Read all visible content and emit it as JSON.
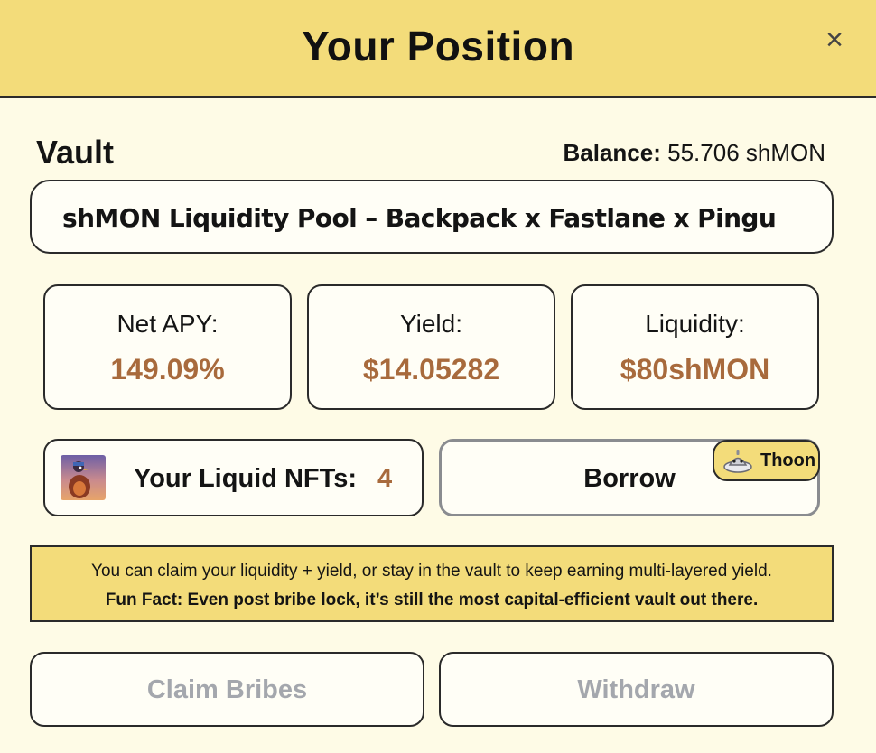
{
  "header": {
    "title": "Your Position",
    "close_icon": "close-icon"
  },
  "vault": {
    "label": "Vault",
    "balance_label": "Balance:",
    "balance_value": "55.706 shMON",
    "pool_name": "shMON Liquidity Pool – Backpack x Fastlane x Pingu"
  },
  "stats": [
    {
      "label": "Net APY:",
      "value": "149.09%"
    },
    {
      "label": "Yield:",
      "value": "$14.05282"
    },
    {
      "label": "Liquidity:",
      "value": "$80shMON"
    }
  ],
  "nfts": {
    "label": "Your Liquid NFTs:",
    "count": "4"
  },
  "borrow": {
    "label": "Borrow",
    "badge": "Thoon"
  },
  "notice": {
    "line1": "You can claim your liquidity + yield, or stay in the vault to keep earning multi-layered yield.",
    "line2": "Fun Fact: Even post bribe lock, it’s still the most capital-efficient vault out there."
  },
  "actions": {
    "claim": "Claim Bribes",
    "withdraw": "Withdraw"
  },
  "colors": {
    "header_bg": "#f3dc7a",
    "page_bg": "#fefbe6",
    "accent_value": "#a86a3c",
    "disabled_text": "#a4a7ad"
  }
}
